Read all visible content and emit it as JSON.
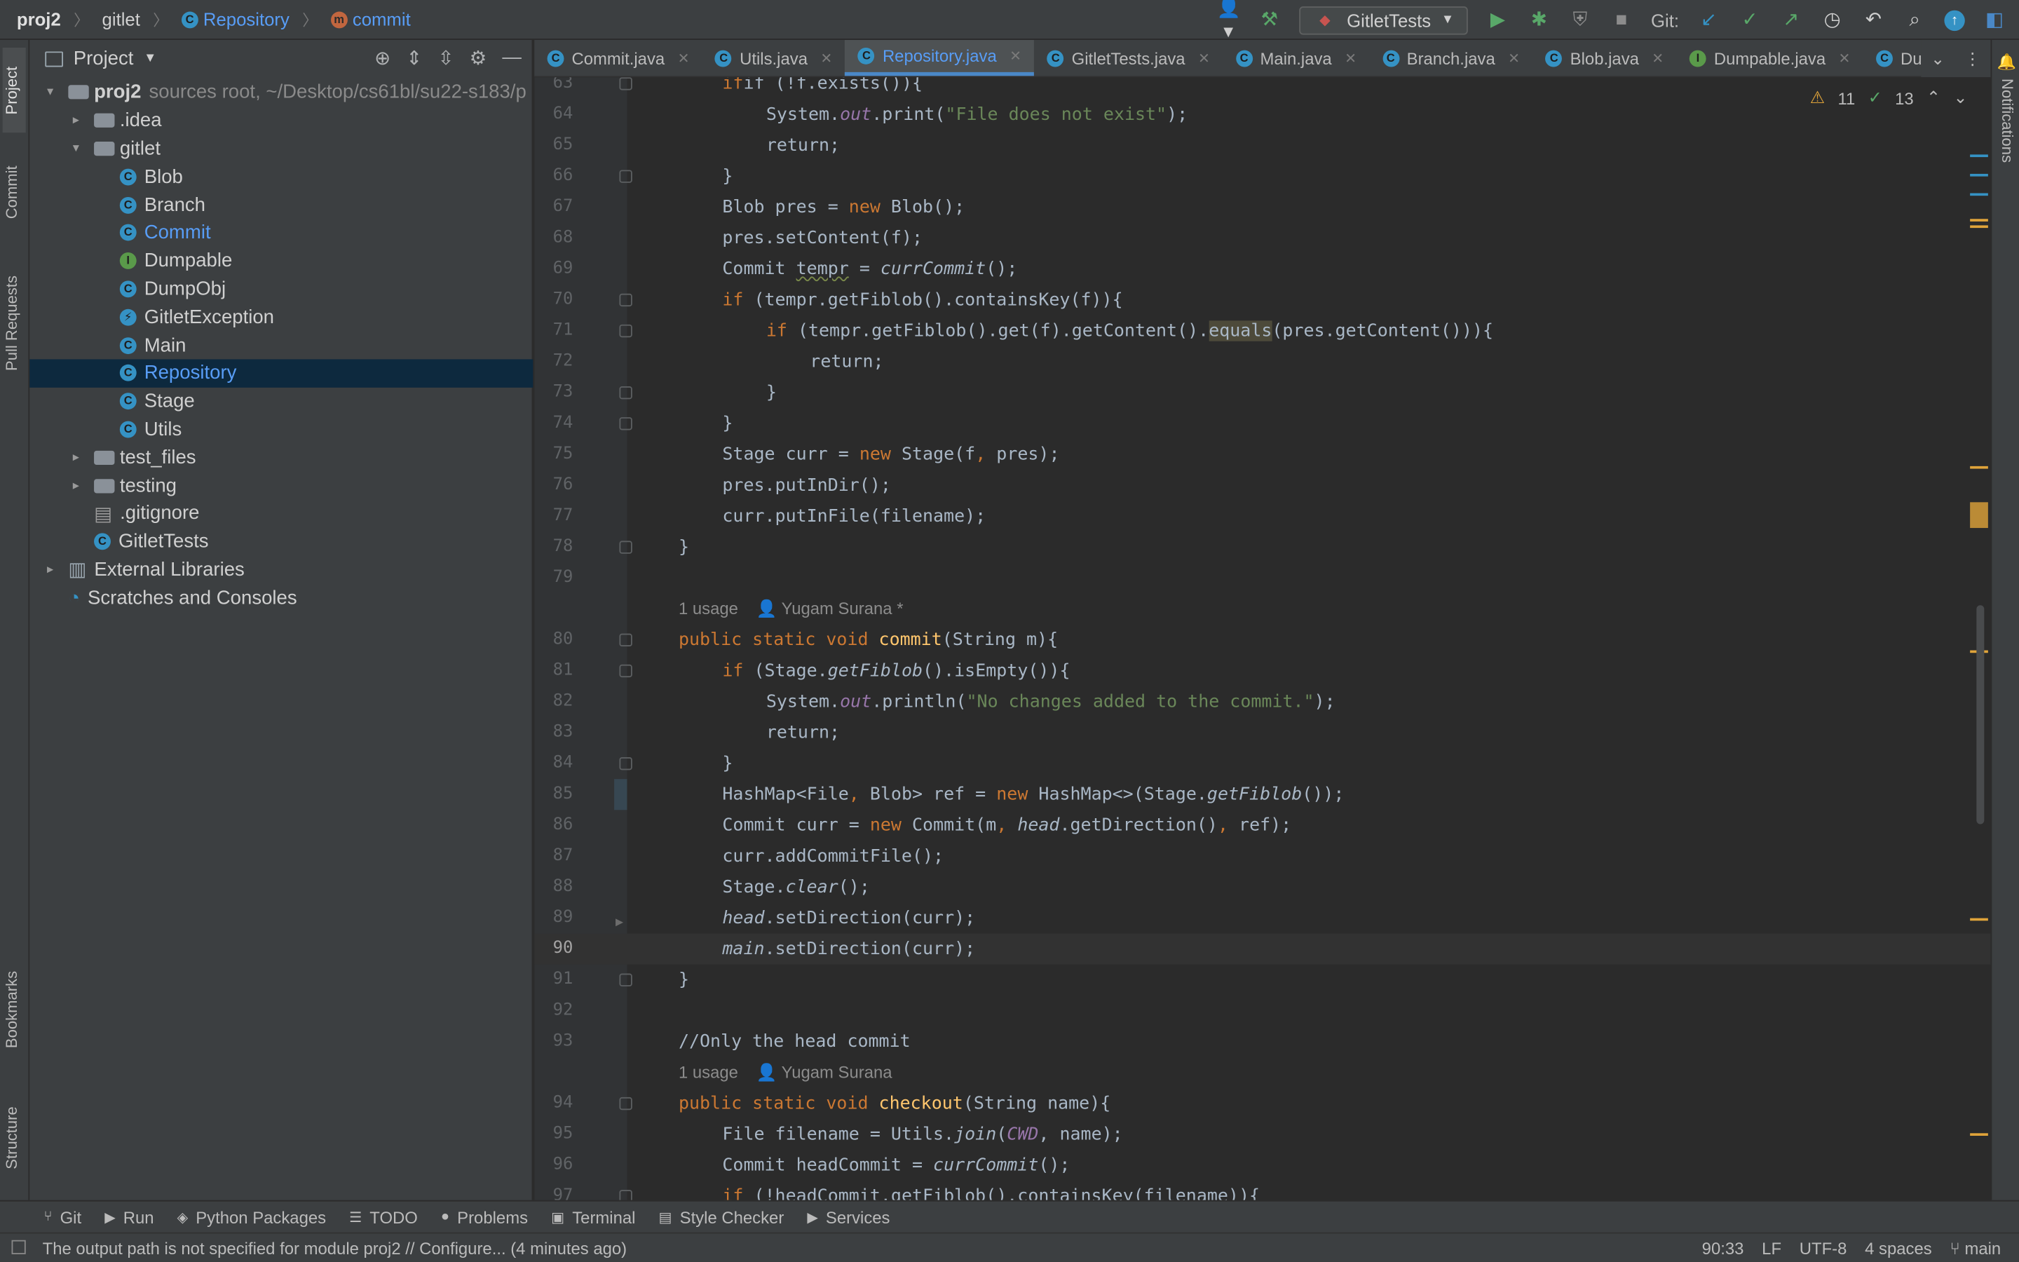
{
  "breadcrumb": {
    "project": "proj2",
    "package": "gitlet",
    "class": "Repository",
    "method": "commit"
  },
  "toolbar": {
    "run_config": "GitletTests",
    "git_label": "Git:"
  },
  "left_strip": {
    "project": "Project",
    "commit": "Commit",
    "pull_requests": "Pull Requests",
    "bookmarks": "Bookmarks",
    "structure": "Structure"
  },
  "right_strip": {
    "notifications": "Notifications"
  },
  "project_panel": {
    "title": "Project",
    "tree": [
      {
        "label": "proj2",
        "extra": "sources root,  ~/Desktop/cs61bl/su22-s183/p",
        "depth": 0,
        "arrow": "▾",
        "kind": "module"
      },
      {
        "label": ".idea",
        "depth": 1,
        "arrow": "▸",
        "kind": "folder"
      },
      {
        "label": "gitlet",
        "depth": 1,
        "arrow": "▾",
        "kind": "package"
      },
      {
        "label": "Blob",
        "depth": 2,
        "kind": "class"
      },
      {
        "label": "Branch",
        "depth": 2,
        "kind": "class"
      },
      {
        "label": "Commit",
        "depth": 2,
        "kind": "class-modified"
      },
      {
        "label": "Dumpable",
        "depth": 2,
        "kind": "interface"
      },
      {
        "label": "DumpObj",
        "depth": 2,
        "kind": "class"
      },
      {
        "label": "GitletException",
        "depth": 2,
        "kind": "exception"
      },
      {
        "label": "Main",
        "depth": 2,
        "kind": "class"
      },
      {
        "label": "Repository",
        "depth": 2,
        "kind": "class-modified",
        "selected": true
      },
      {
        "label": "Stage",
        "depth": 2,
        "kind": "class"
      },
      {
        "label": "Utils",
        "depth": 2,
        "kind": "class"
      },
      {
        "label": "test_files",
        "depth": 1,
        "arrow": "▸",
        "kind": "folder"
      },
      {
        "label": "testing",
        "depth": 1,
        "arrow": "▸",
        "kind": "folder"
      },
      {
        "label": ".gitignore",
        "depth": 1,
        "kind": "file"
      },
      {
        "label": "GitletTests",
        "depth": 1,
        "kind": "class"
      },
      {
        "label": "External Libraries",
        "depth": 0,
        "arrow": "▸",
        "kind": "libraries"
      },
      {
        "label": "Scratches and Consoles",
        "depth": 0,
        "kind": "scratches"
      }
    ]
  },
  "tabs": [
    {
      "label": "Commit.java",
      "active": false
    },
    {
      "label": "Utils.java",
      "active": false
    },
    {
      "label": "Repository.java",
      "active": true
    },
    {
      "label": "GitletTests.java",
      "active": false
    },
    {
      "label": "Main.java",
      "active": false
    },
    {
      "label": "Branch.java",
      "active": false
    },
    {
      "label": "Blob.java",
      "active": false
    },
    {
      "label": "Dumpable.java",
      "active": false
    },
    {
      "label": "DumpObj.ja",
      "active": false
    }
  ],
  "inspection": {
    "warnings": "11",
    "ok": "13"
  },
  "hints": {
    "h1": "1 usage",
    "h1_author": "Yugam Surana *",
    "h2": "1 usage",
    "h2_author": "Yugam Surana"
  },
  "code": {
    "l63": "if (!f.exists()){",
    "l64_a": "System.",
    "l64_b": "out",
    "l64_c": ".print(",
    "l64_d": "\"File does not exist\"",
    "l64_e": ");",
    "l65": "return;",
    "l66": "}",
    "l67_a": "Blob pres = ",
    "l67_b": "new",
    "l67_c": " Blob();",
    "l68": "pres.setContent(f);",
    "l69_a": "Commit ",
    "l69_b": "tempr",
    "l69_c": " = ",
    "l69_d": "currCommit",
    "l69_e": "();",
    "l70_a": "if",
    "l70_b": " (tempr.getFiblob().containsKey(f)){",
    "l71_a": "if",
    "l71_b": " (tempr.getFiblob().get(f).getContent().",
    "l71_c": "equals",
    "l71_d": "(pres.getContent())){",
    "l72": "return;",
    "l73": "}",
    "l74": "}",
    "l75_a": "Stage curr = ",
    "l75_b": "new",
    "l75_c": " Stage(f",
    "l75_d": ",",
    "l75_e": " pres);",
    "l76": "pres.putInDir();",
    "l77": "curr.putInFile(filename);",
    "l78": "}",
    "l80_a": "public static void ",
    "l80_b": "commit",
    "l80_c": "(String m){",
    "l81_a": "if",
    "l81_b": " (Stage.",
    "l81_c": "getFiblob",
    "l81_d": "().isEmpty()){",
    "l82_a": "System.",
    "l82_b": "out",
    "l82_c": ".println(",
    "l82_d": "\"No changes added to the commit.\"",
    "l82_e": ");",
    "l83": "return;",
    "l84": "}",
    "l85_a": "HashMap<File",
    "l85_b": ",",
    "l85_c": " Blob> ref = ",
    "l85_d": "new",
    "l85_e": " HashMap<>(Stage.",
    "l85_f": "getFiblob",
    "l85_g": "());",
    "l86_a": "Commit curr = ",
    "l86_b": "new",
    "l86_c": " Commit(m",
    "l86_d": ",",
    "l86_e": " ",
    "l86_f": "head",
    "l86_g": ".getDirection()",
    "l86_h": ",",
    "l86_i": " ref);",
    "l87": "curr.addCommitFile();",
    "l88_a": "Stage.",
    "l88_b": "clear",
    "l88_c": "();",
    "l89_a": "head",
    "l89_b": ".setDirection(curr);",
    "l90_a": "main",
    "l90_b": ".setDirection(curr);",
    "l91": "}",
    "l93": "//Only the head commit",
    "l94_a": "public static void ",
    "l94_b": "checkout",
    "l94_c": "(String name){",
    "l95_a": "File filename = Utils.",
    "l95_b": "join",
    "l95_c": "(",
    "l95_d": "CWD",
    "l95_e": ", name);",
    "l96_a": "Commit headCommit = ",
    "l96_b": "currCommit",
    "l96_c": "();",
    "l97_a": "if",
    "l97_b": " (!headCommit.getFiblob().containsKey(filename)){"
  },
  "line_numbers": [
    "63",
    "64",
    "65",
    "66",
    "67",
    "68",
    "69",
    "70",
    "71",
    "72",
    "73",
    "74",
    "75",
    "76",
    "77",
    "78",
    "79",
    "80",
    "81",
    "82",
    "83",
    "84",
    "85",
    "86",
    "87",
    "88",
    "89",
    "90",
    "91",
    "92",
    "93",
    "94",
    "95",
    "96",
    "97"
  ],
  "bottom_tools": [
    {
      "label": "Git",
      "icon": "git-branch-icon"
    },
    {
      "label": "Run",
      "icon": "run-icon"
    },
    {
      "label": "Python Packages",
      "icon": "layers-icon"
    },
    {
      "label": "TODO",
      "icon": "list-icon"
    },
    {
      "label": "Problems",
      "icon": "info-icon"
    },
    {
      "label": "Terminal",
      "icon": "terminal-icon"
    },
    {
      "label": "Style Checker",
      "icon": "checker-icon"
    },
    {
      "label": "Services",
      "icon": "services-icon"
    }
  ],
  "status": {
    "message": "The output path is not specified for module proj2 // Configure... (4 minutes ago)",
    "position": "90:33",
    "line_sep": "LF",
    "encoding": "UTF-8",
    "indent": "4 spaces",
    "branch": "main"
  }
}
